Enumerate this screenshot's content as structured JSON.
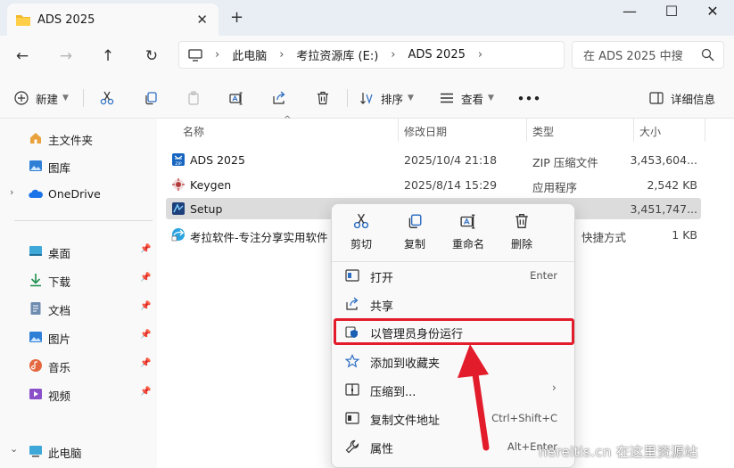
{
  "window": {
    "tab_title": "ADS 2025",
    "minimize": "—",
    "maximize": "☐",
    "close": "✕"
  },
  "address": {
    "crumbs": [
      "此电脑",
      "考拉资源库 (E:)",
      "ADS 2025"
    ],
    "search_placeholder": "在 ADS 2025 中搜"
  },
  "toolbar": {
    "new_label": "新建",
    "sort_label": "排序",
    "view_label": "查看",
    "more_label": "•••",
    "details_label": "详细信息"
  },
  "sidebar": {
    "items": [
      {
        "label": "主文件夹",
        "icon": "home-icon"
      },
      {
        "label": "图库",
        "icon": "gallery-icon"
      },
      {
        "label": "OneDrive",
        "icon": "onedrive-icon"
      },
      {
        "label": "桌面",
        "icon": "desktop-icon"
      },
      {
        "label": "下载",
        "icon": "download-icon"
      },
      {
        "label": "文档",
        "icon": "document-icon"
      },
      {
        "label": "图片",
        "icon": "pictures-icon"
      },
      {
        "label": "音乐",
        "icon": "music-icon"
      },
      {
        "label": "视频",
        "icon": "video-icon"
      },
      {
        "label": "此电脑",
        "icon": "computer-icon"
      }
    ]
  },
  "filelist": {
    "columns": [
      "名称",
      "修改日期",
      "类型",
      "大小"
    ],
    "rows": [
      {
        "name": "ADS 2025",
        "date": "2025/10/4 21:18",
        "type": "ZIP 压缩文件",
        "size": "3,453,604...",
        "icon": "zip-icon"
      },
      {
        "name": "Keygen",
        "date": "2025/8/14 15:29",
        "type": "应用程序",
        "size": "2,542 KB",
        "icon": "keygen-icon"
      },
      {
        "name": "Setup",
        "date": "",
        "type": "",
        "size": "3,451,747...",
        "icon": "setup-icon"
      },
      {
        "name": "考拉软件-专注分享实用软件",
        "date": "",
        "type": "快捷方式",
        "size": "1 KB",
        "icon": "shortcut-icon"
      }
    ]
  },
  "context_menu": {
    "quick_actions": [
      "剪切",
      "复制",
      "重命名",
      "删除"
    ],
    "items": [
      {
        "label": "打开",
        "shortcut": "Enter"
      },
      {
        "label": "共享",
        "shortcut": ""
      },
      {
        "label": "以管理员身份运行",
        "shortcut": ""
      },
      {
        "label": "添加到收藏夹",
        "shortcut": ""
      },
      {
        "label": "压缩到...",
        "shortcut": ""
      },
      {
        "label": "复制文件地址",
        "shortcut": "Ctrl+Shift+C"
      },
      {
        "label": "属性",
        "shortcut": "Alt+Enter"
      }
    ]
  },
  "watermark": "hereitis.cn 在这里资源站",
  "colors": {
    "highlight_border": "#e21c2b",
    "arrow": "#e21c2b",
    "selection": "#dcdcdc"
  }
}
